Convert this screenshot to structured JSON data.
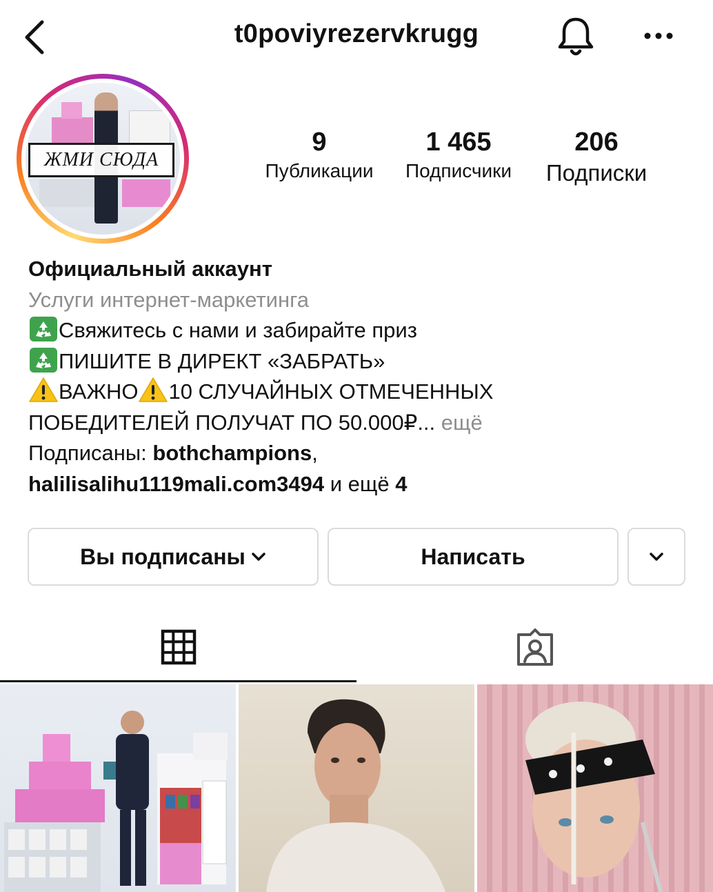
{
  "header": {
    "username": "t0poviyrezervkrugg",
    "back_icon": "chevron-left-icon",
    "bell_icon": "bell-icon",
    "more_icon": "more-horizontal-icon"
  },
  "avatar": {
    "overlay_text": "ЖМИ СЮДА",
    "story_ring": true
  },
  "stats": {
    "posts": {
      "value": "9",
      "label": "Публикации"
    },
    "followers": {
      "value": "1 465",
      "label": "Подписчики"
    },
    "following": {
      "value": "206",
      "label": "Подписки"
    }
  },
  "bio": {
    "name": "Официальный аккаунт",
    "category": "Услуги интернет-маркетинга",
    "line1": "Свяжитесь с нами и забирайте приз",
    "line2": "ПИШИТЕ В ДИРЕКТ «ЗАБРАТЬ»",
    "line3_a": "ВАЖНО",
    "line3_b": "10 СЛУЧАЙНЫХ ОТМЕЧЕННЫХ",
    "line4": "ПОБЕДИТЕЛЕЙ ПОЛУЧАТ ПО 50.000₽",
    "line4_more_prefix": "...",
    "more": "ещё",
    "followed_by_label": "Подписаны: ",
    "followed_by_user1": "bothchampions",
    "followed_by_sep": ",",
    "followed_by_user2": "halilisalihu1119mali.com3494",
    "followed_by_and": " и ещё ",
    "followed_by_count": "4"
  },
  "actions": {
    "follow_label": "Вы подписаны",
    "message_label": "Написать",
    "suggest_icon": "chevron-down-icon"
  },
  "tabs": [
    {
      "name": "posts",
      "icon": "grid-icon",
      "active": true
    },
    {
      "name": "tagged",
      "icon": "tagged-user-icon",
      "active": false
    }
  ],
  "colors": {
    "text": "#111111",
    "secondary": "#8e8e8e",
    "border": "#dbdbdb",
    "ring_start": "#feda75",
    "ring_end": "#d62976"
  }
}
